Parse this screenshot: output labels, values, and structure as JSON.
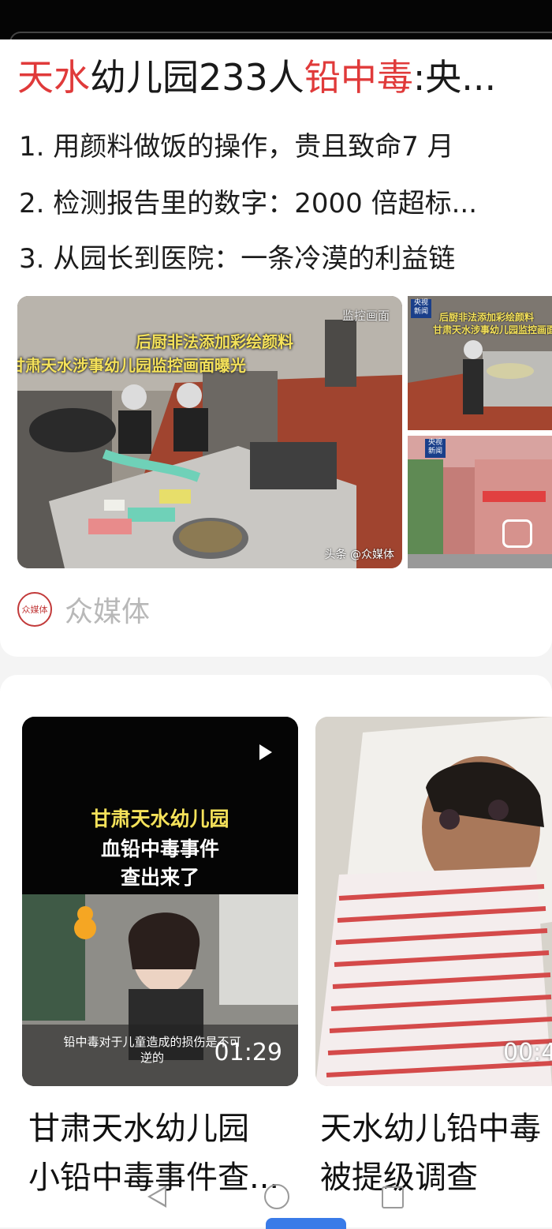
{
  "article": {
    "headline": {
      "seg1": "天水",
      "seg2": "幼儿园233人",
      "seg3": "铅中毒",
      "seg4": ":央..."
    },
    "points": [
      "1. 用颜料做饭的操作，贵且致命7 月",
      "2. 检测报告里的数字：2000 倍超标...",
      "3. 从园长到医院：一条冷漠的利益链"
    ],
    "main_image": {
      "overlay_line1": "后厨非法添加彩绘颜料",
      "overlay_line2": "甘肃天水涉事幼儿园监控画面曝光",
      "tag": "监控画面",
      "watermark": "头条 @众媒体"
    },
    "side_image1": {
      "badge": "央视新闻",
      "line1": "后厨非法添加彩绘颜料",
      "line2": "甘肃天水涉事幼儿园监控画面"
    },
    "side_image2": {
      "badge": "央视新闻"
    },
    "source": {
      "logo_text": "众媒体",
      "name": "众媒体"
    }
  },
  "videos": [
    {
      "overlay_line1": "甘肃天水幼儿园",
      "overlay_line2": "血铅中毒事件",
      "overlay_line3": "查出来了",
      "subtitle": "铅中毒对于儿童造成的损伤是不可逆的",
      "duration": "01:29",
      "title_line1": "甘肃天水幼儿园",
      "title_line2": "小铅中毒事件查..."
    },
    {
      "duration": "00:4",
      "title_line1": "天水幼儿铅中毒",
      "title_line2": "被提级调查"
    }
  ],
  "icons": {
    "play": "play-icon",
    "nav_back": "back-triangle-icon",
    "nav_home": "home-circle-icon",
    "nav_recent": "recent-square-icon"
  },
  "colors": {
    "accent_red": "#e03a3a",
    "overlay_yellow": "#f5e25a",
    "nav_blue": "#3a7be8"
  }
}
